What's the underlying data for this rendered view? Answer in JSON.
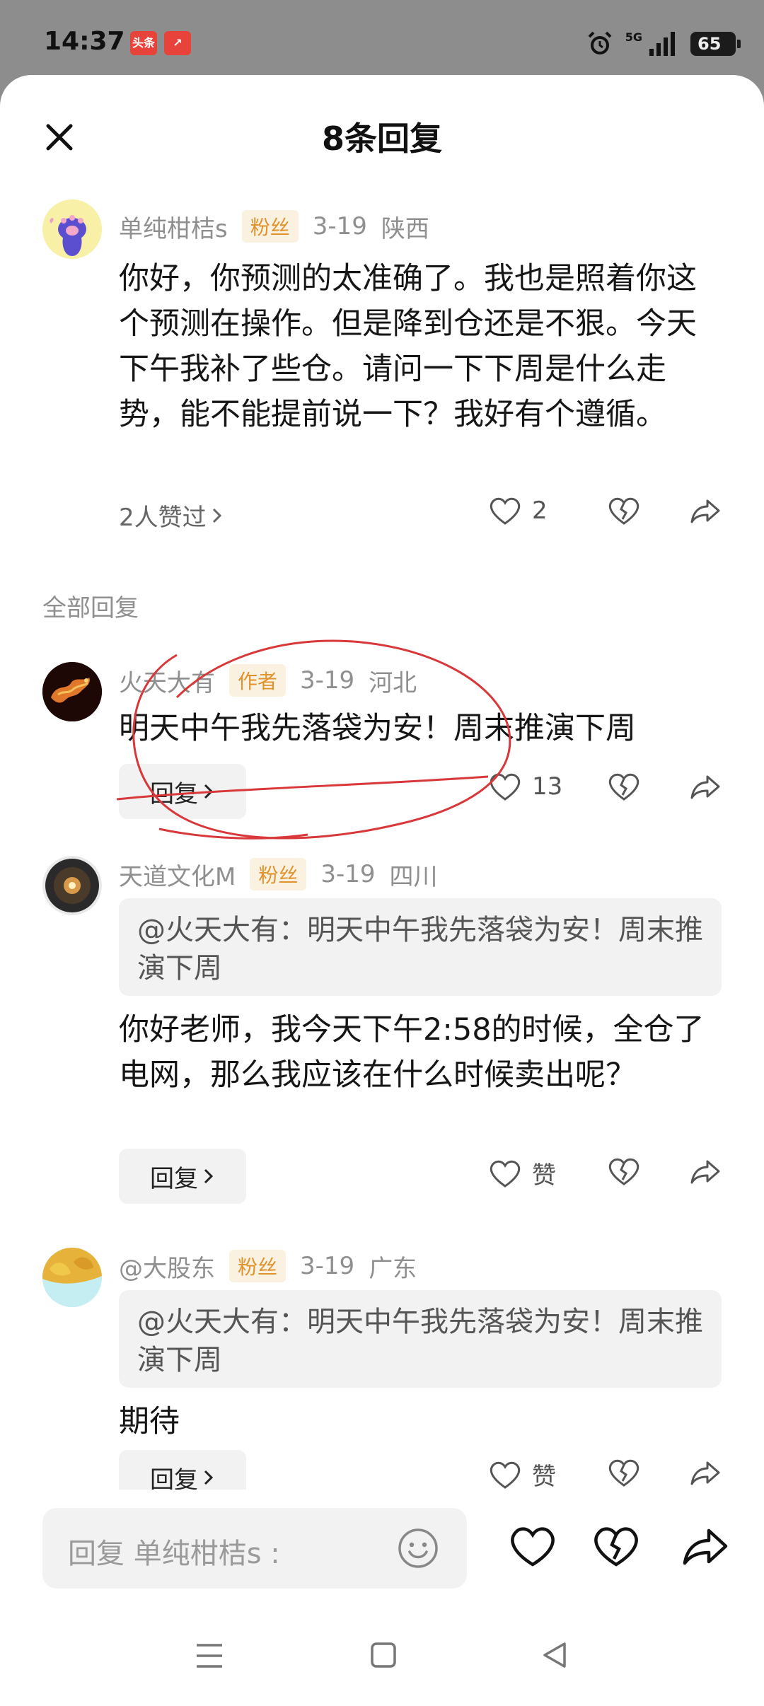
{
  "status_bar": {
    "time": "14:37",
    "app_icons": [
      "头条",
      "↗"
    ],
    "network": "5G",
    "battery": "65"
  },
  "sheet": {
    "title": "8条回复"
  },
  "main_comment": {
    "author": "单纯柑桔s",
    "tag": "粉丝",
    "date": "3-19",
    "region": "陕西",
    "text": "你好，你预测的太准确了。我也是照着你这个预测在操作。但是降到仓还是不狠。今天下午我补了些仓。请问一下下周是什么走势，能不能提前说一下？我好有个遵循。",
    "likes_link": "2人赞过",
    "like_count": "2"
  },
  "section_label": "全部回复",
  "replies": [
    {
      "author": "火天大有",
      "tag": "作者",
      "date": "3-19",
      "region": "河北",
      "text": "明天中午我先落袋为安！周末推演下周",
      "reply_label": "回复",
      "like_count": "13"
    },
    {
      "author": "天道文化M",
      "tag": "粉丝",
      "date": "3-19",
      "region": "四川",
      "quote": "@火天大有：明天中午我先落袋为安！周末推演下周",
      "text": "你好老师，我今天下午2:58的时候，全仓了电网，那么我应该在什么时候卖出呢？",
      "reply_label": "回复",
      "like_count": "赞"
    },
    {
      "author": "@大股东",
      "tag": "粉丝",
      "date": "3-19",
      "region": "广东",
      "quote": "@火天大有：明天中午我先落袋为安！周末推演下周",
      "text": "期待",
      "reply_label": "回复",
      "like_count": "赞"
    }
  ],
  "composer": {
    "placeholder": "回复 单纯柑桔s :"
  },
  "colors": {
    "tag_bg": "#fbf1e1",
    "tag_text": "#e0932d",
    "annotation": "#d8383a"
  }
}
